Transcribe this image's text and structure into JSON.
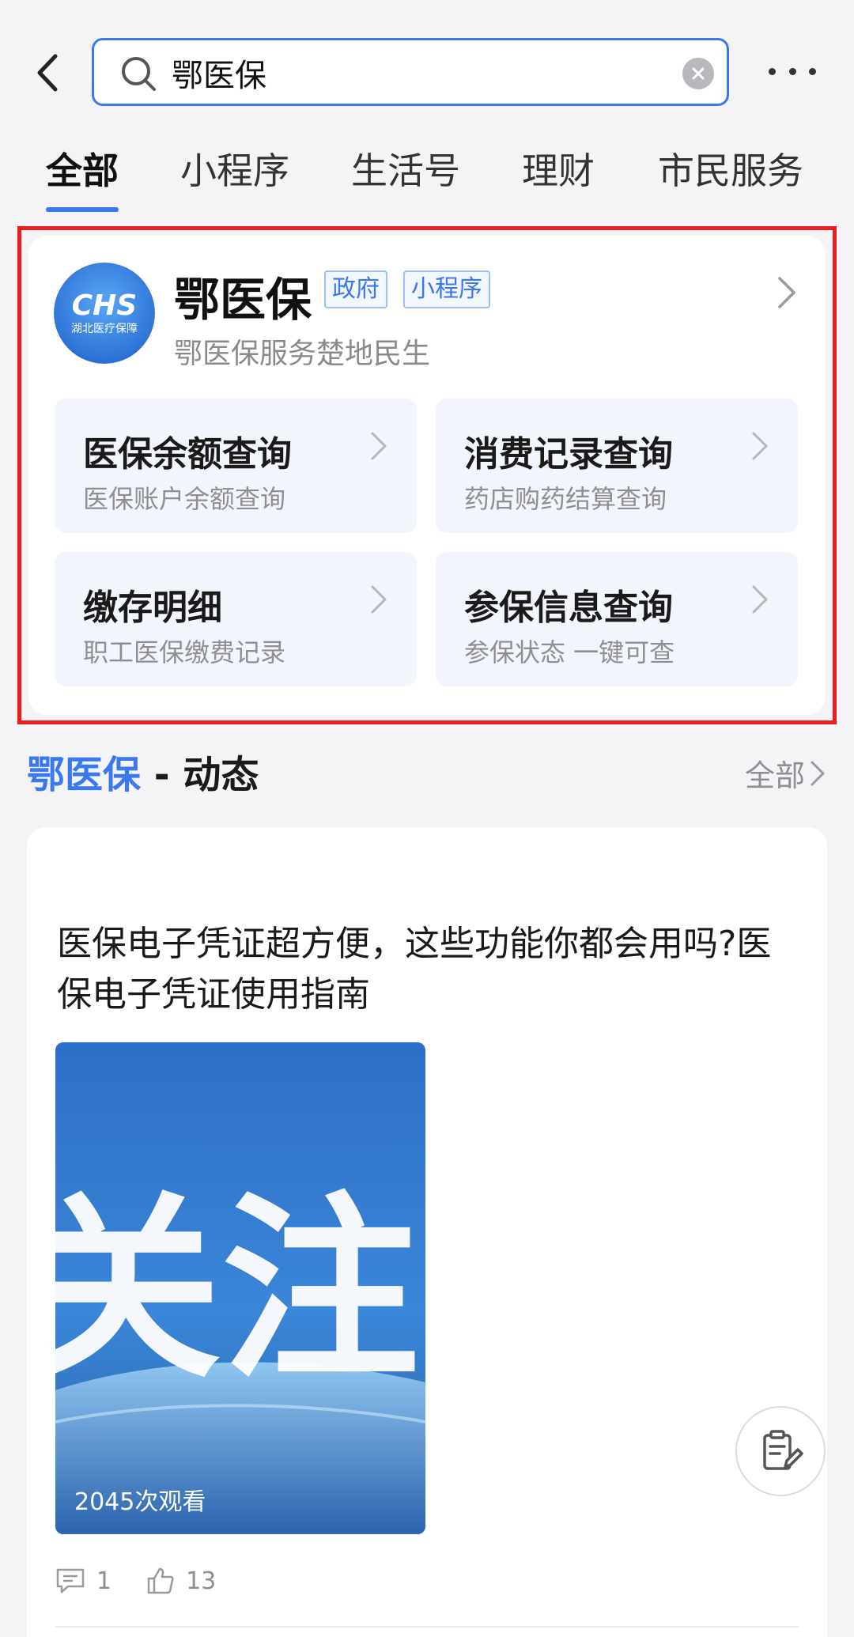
{
  "search": {
    "query": "鄂医保"
  },
  "tabs": [
    {
      "label": "全部",
      "active": true
    },
    {
      "label": "小程序"
    },
    {
      "label": "生活号"
    },
    {
      "label": "理财"
    },
    {
      "label": "市民服务"
    }
  ],
  "app_card": {
    "name": "鄂医保",
    "tags": [
      "政府",
      "小程序"
    ],
    "description": "鄂医保服务楚地民生",
    "logo_text": "CHS",
    "logo_subtext": "湖北医疗保障",
    "services": [
      {
        "title": "医保余额查询",
        "subtitle": "医保账户余额查询"
      },
      {
        "title": "消费记录查询",
        "subtitle": "药店购药结算查询"
      },
      {
        "title": "缴存明细",
        "subtitle": "职工医保缴费记录"
      },
      {
        "title": "参保信息查询",
        "subtitle": "参保状态 一键可查"
      }
    ]
  },
  "feed": {
    "brand": "鄂医保",
    "title_suffix": " - 动态",
    "all_label": "全部",
    "post": {
      "title": "医保电子凭证超方便，这些功能你都会用吗?医保电子凭证使用指南",
      "image_text": "关注",
      "views": "2045次观看",
      "comments": "1",
      "likes": "13"
    }
  },
  "colors": {
    "accent": "#3a78f2",
    "highlight": "#ee1c1c"
  }
}
